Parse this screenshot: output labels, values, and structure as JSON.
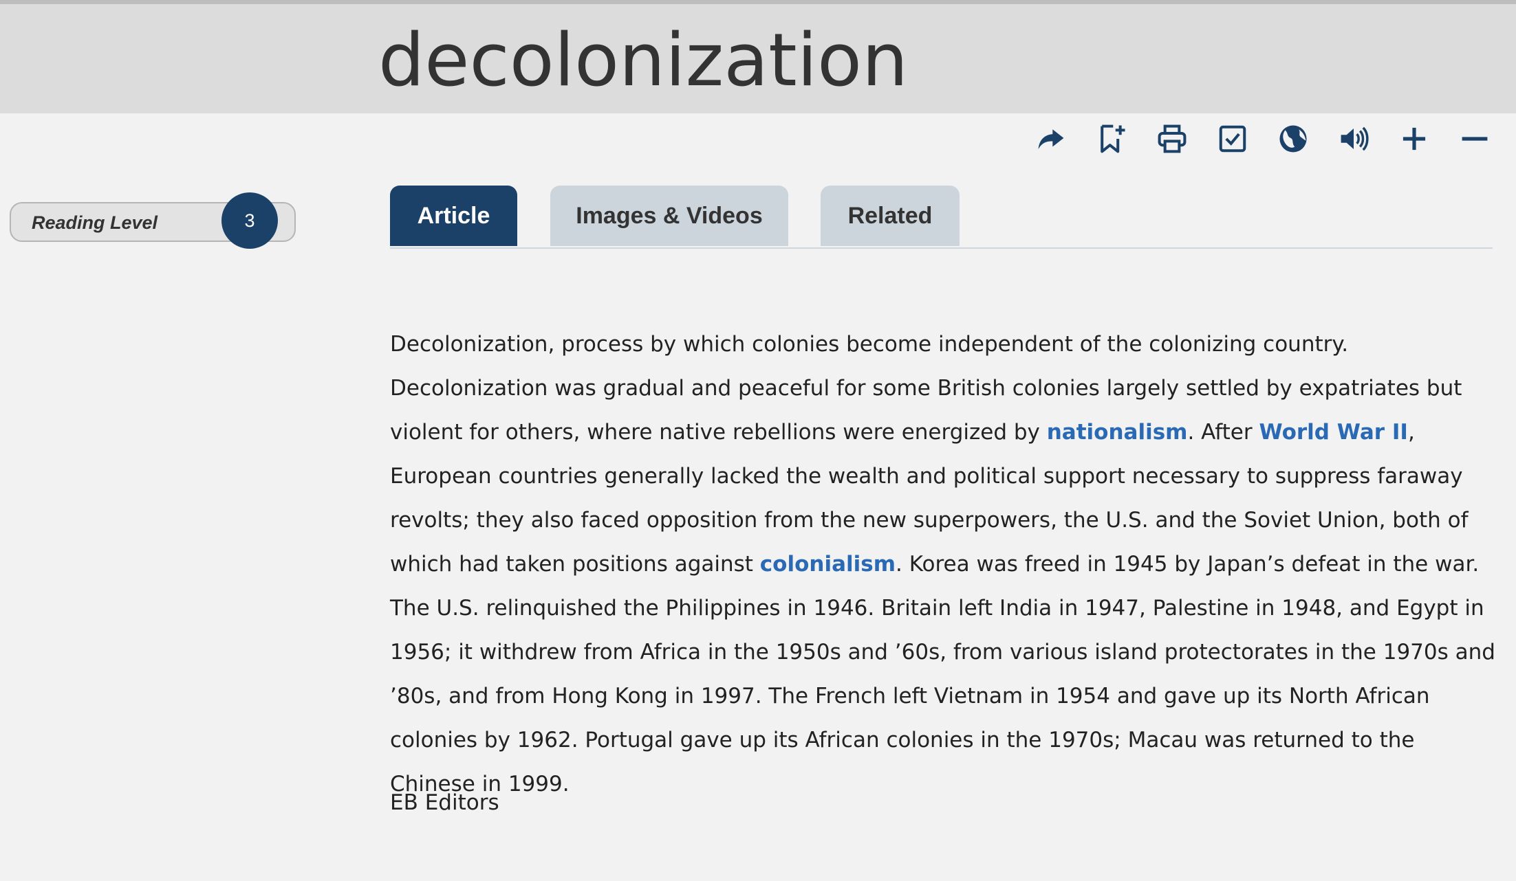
{
  "header": {
    "title": "decolonization"
  },
  "toolbar": {
    "icons": [
      "share-icon",
      "bookmark-add-icon",
      "print-icon",
      "checkbox-icon",
      "globe-icon",
      "audio-icon",
      "zoom-in-icon",
      "zoom-out-icon"
    ]
  },
  "reading_level": {
    "label": "Reading Level",
    "value": "3"
  },
  "tabs": [
    {
      "label": "Article",
      "active": true
    },
    {
      "label": "Images & Videos",
      "active": false
    },
    {
      "label": "Related",
      "active": false
    }
  ],
  "article": {
    "p1": "Decolonization, process by which colonies become independent of the colonizing country. Decolonization was gradual and peaceful for some British colonies largely settled by expatriates but violent for others, where native rebellions were energized by ",
    "link_nationalism": "nationalism",
    "p2": ". After ",
    "link_ww2": "World War II",
    "p3": ", European countries generally lacked the wealth and political support necessary to suppress faraway revolts; they also faced opposition from the new superpowers, the U.S. and the Soviet Union, both of which had taken positions against ",
    "link_colonialism": "colonialism",
    "p4": ". Korea was freed in 1945 by Japan’s defeat in the war. The U.S. relinquished the Philippines in 1946. Britain left India in 1947, Palestine in 1948, and Egypt in 1956; it withdrew from Africa in the 1950s and ’60s, from various island protectorates in the 1970s and ’80s, and from Hong Kong in 1997. The French left Vietnam in 1954 and gave up its North African colonies by 1962. Portugal gave up its African colonies in the 1970s; Macau was returned to the Chinese in 1999.",
    "byline": "EB Editors"
  },
  "colors": {
    "primary": "#1b4168",
    "link": "#2a6ab5",
    "tab_inactive": "#cdd5dc",
    "header_bg": "#dcdcdc",
    "page_bg": "#f2f2f2"
  }
}
